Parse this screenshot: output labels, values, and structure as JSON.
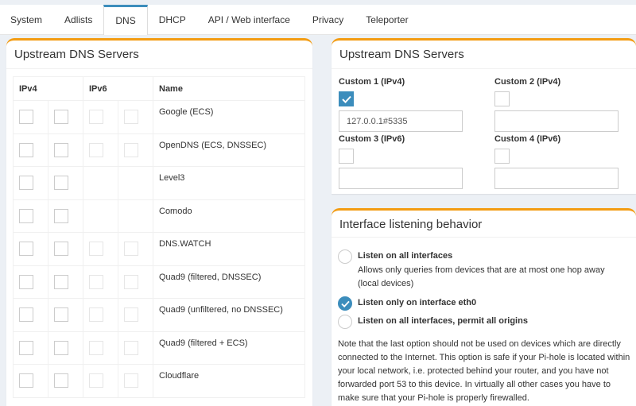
{
  "tabs": [
    {
      "label": "System"
    },
    {
      "label": "Adlists"
    },
    {
      "label": "DNS"
    },
    {
      "label": "DHCP"
    },
    {
      "label": "API / Web interface"
    },
    {
      "label": "Privacy"
    },
    {
      "label": "Teleporter"
    }
  ],
  "active_tab": "DNS",
  "left_box": {
    "title": "Upstream DNS Servers",
    "headers": {
      "ipv4": "IPv4",
      "ipv6": "IPv6",
      "name": "Name"
    },
    "servers": [
      {
        "name": "Google (ECS)",
        "ipv6": true
      },
      {
        "name": "OpenDNS (ECS, DNSSEC)",
        "ipv6": true
      },
      {
        "name": "Level3",
        "ipv6": false
      },
      {
        "name": "Comodo",
        "ipv6": false
      },
      {
        "name": "DNS.WATCH",
        "ipv6": true
      },
      {
        "name": "Quad9 (filtered, DNSSEC)",
        "ipv6": true
      },
      {
        "name": "Quad9 (unfiltered, no DNSSEC)",
        "ipv6": true
      },
      {
        "name": "Quad9 (filtered + ECS)",
        "ipv6": true
      },
      {
        "name": "Cloudflare",
        "ipv6": true
      }
    ]
  },
  "right_box": {
    "title": "Upstream DNS Servers",
    "custom1": {
      "label": "Custom 1 (IPv4)",
      "checked": true,
      "value": "127.0.0.1#5335"
    },
    "custom2": {
      "label": "Custom 2 (IPv4)",
      "checked": false,
      "value": ""
    },
    "custom3": {
      "label": "Custom 3 (IPv6)",
      "checked": false,
      "value": ""
    },
    "custom4": {
      "label": "Custom 4 (IPv6)",
      "checked": false,
      "value": ""
    }
  },
  "interface_box": {
    "title": "Interface listening behavior",
    "options": [
      {
        "label": "Listen on all interfaces",
        "desc": "Allows only queries from devices that are at most one hop away (local devices)",
        "selected": false
      },
      {
        "label": "Listen only on interface eth0",
        "selected": true
      },
      {
        "label": "Listen on all interfaces, permit all origins",
        "selected": false
      }
    ],
    "note": "Note that the last option should not be used on devices which are directly connected to the Internet. This option is safe if your Pi-hole is located within your local network, i.e. protected behind your router, and you have not forwarded port 53 to this device. In virtually all other cases you have to make sure that your Pi-hole is properly firewalled."
  },
  "colors": {
    "accent": "#3c8dbc",
    "box_border": "#f39c12"
  }
}
